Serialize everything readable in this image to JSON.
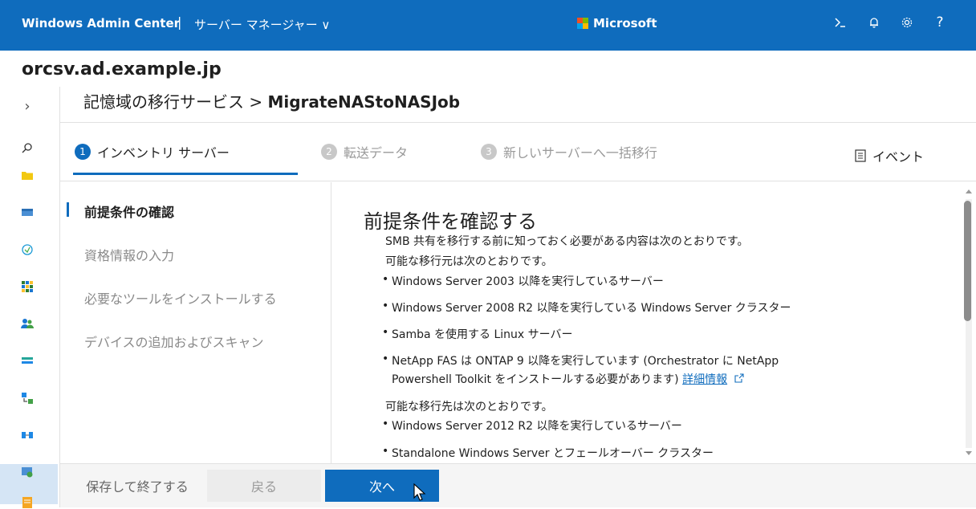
{
  "topbar": {
    "brand": "Windows Admin Center",
    "separator": "|",
    "server_manager": "サーバー マネージャー ∨",
    "microsoft": "Microsoft",
    "icons": [
      "terminal-icon",
      "bell-icon",
      "gear-icon",
      "help-icon"
    ]
  },
  "page": {
    "title": "orcsv.ad.example.jp",
    "breadcrumb_service": "記憶域の移行サービス",
    "breadcrumb_sep": ">",
    "breadcrumb_job": "MigrateNAStoNASJob"
  },
  "steps": [
    {
      "num": "1",
      "label": "インベントリ サーバー",
      "active": true
    },
    {
      "num": "2",
      "label": "転送データ",
      "active": false
    },
    {
      "num": "3",
      "label": "新しいサーバーへ一括移行",
      "active": false
    }
  ],
  "events_label": "イベント",
  "substeps": [
    {
      "label": "前提条件の確認",
      "active": true
    },
    {
      "label": "資格情報の入力",
      "active": false
    },
    {
      "label": "必要なツールをインストールする",
      "active": false
    },
    {
      "label": "デバイスの追加およびスキャン",
      "active": false
    }
  ],
  "content": {
    "heading": "前提条件を確認する",
    "intro": "SMB 共有を移行する前に知っておく必要がある内容は次のとおりです。",
    "sources_label": "可能な移行元は次のとおりです。",
    "sources": [
      "Windows Server 2003 以降を実行しているサーバー",
      "Windows Server 2008 R2 以降を実行している Windows Server クラスター",
      "Samba を使用する Linux サーバー",
      "NetApp FAS は ONTAP 9 以降を実行しています (Orchestrator に NetApp"
    ],
    "netapp_line2": "Powershell Toolkit をインストールする必要があります)",
    "more_info": "詳細情報",
    "targets_label": "可能な移行先は次のとおりです。",
    "targets": [
      "Windows Server 2012 R2 以降を実行しているサーバー",
      "Standalone Windows Server とフェールオーバー クラスター"
    ]
  },
  "footer": {
    "save_exit": "保存して終了する",
    "back": "戻る",
    "next": "次へ"
  },
  "colors": {
    "accent": "#0f6cbd",
    "ms_red": "#f25022",
    "ms_green": "#7fba00",
    "ms_blue": "#00a4ef",
    "ms_yellow": "#ffb900"
  }
}
